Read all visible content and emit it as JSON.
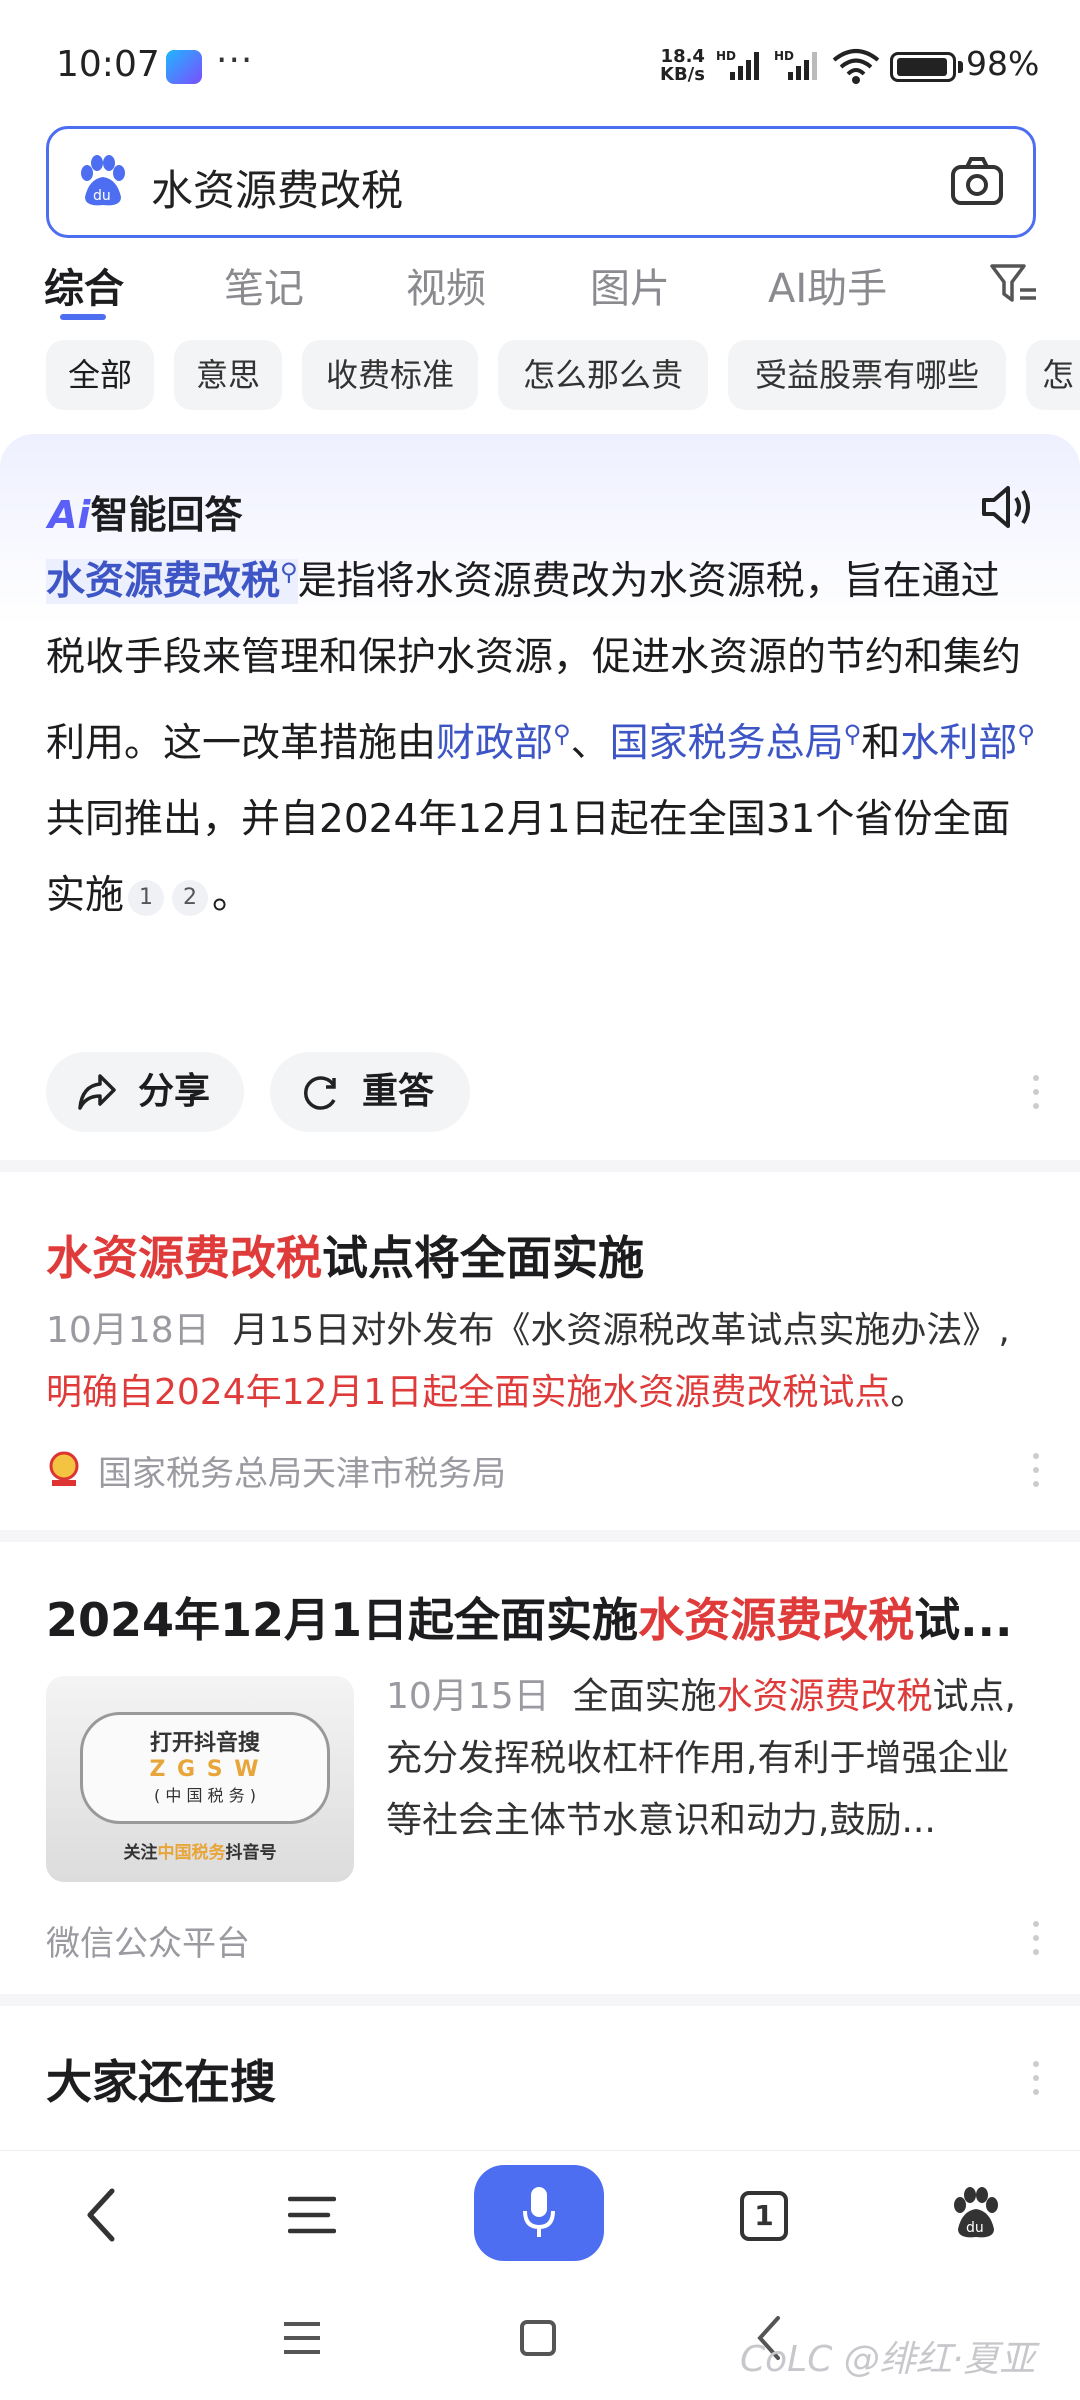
{
  "status": {
    "time": "10:07",
    "net_speed_top": "18.4",
    "net_speed_bottom": "KB/s",
    "hd1": "HD",
    "hd2": "HD",
    "battery": "98%"
  },
  "search": {
    "query": "水资源费改税"
  },
  "tabs": [
    "综合",
    "笔记",
    "视频",
    "图片",
    "AI助手"
  ],
  "chips": [
    "全部",
    "意思",
    "收费标准",
    "怎么那么贵",
    "受益股票有哪些",
    "怎"
  ],
  "ai": {
    "logo_mark": "Ai",
    "logo_text": "智能回答",
    "term": "水资源费改税",
    "t1": "是指将水资源费改为水资源税，旨在通过税收手段来管理和保护水资源，促进水资源的节约和集约利用。这一改革措施由",
    "link1": "财政部",
    "t2": "、",
    "link2": "国家税务总局",
    "t3": "和",
    "link3": "水利部",
    "t4": "共同推出，并自2024年12月1日起在全国31个省份全面实施",
    "ref1": "1",
    "ref2": "2",
    "t5": "。",
    "share": "分享",
    "regen": "重答"
  },
  "results": [
    {
      "title_red": "水资源费改税",
      "title_rest": "试点将全面实施",
      "date": "10月18日",
      "body1": "月15日对外发布《水资源税改革试点实施办法》,",
      "body_red": "明确自2024年12月1日起全面实施水资源费改税试点",
      "body_end": "。",
      "source": "国家税务总局天津市税务局"
    },
    {
      "title_pre": "2024年12月1日起全面实施",
      "title_red": "水资源费改税",
      "title_post": "试...",
      "date": "10月15日",
      "body_pre": "全面实施",
      "body_red": "水资源费改税",
      "body_post": "试点,充分发挥税收杠杆作用,有利于增强企业等社会主体节水意识和动力,鼓励...",
      "thumb_line1": "打开抖音搜",
      "thumb_line2": "Z G S W",
      "thumb_line3": "( 中 国 税 务 )",
      "thumb_line4_pre": "关注",
      "thumb_line4_red": "中国税务",
      "thumb_line4_post": "抖音号",
      "source": "微信公众平台"
    }
  ],
  "also_search": "大家还在搜",
  "tab_count": "1",
  "watermark": "CoLC @绯红·夏亚",
  "colors": {
    "accent": "#4e6ef2",
    "highlight_red": "#e03b3b",
    "link_blue": "#3d55c5"
  }
}
